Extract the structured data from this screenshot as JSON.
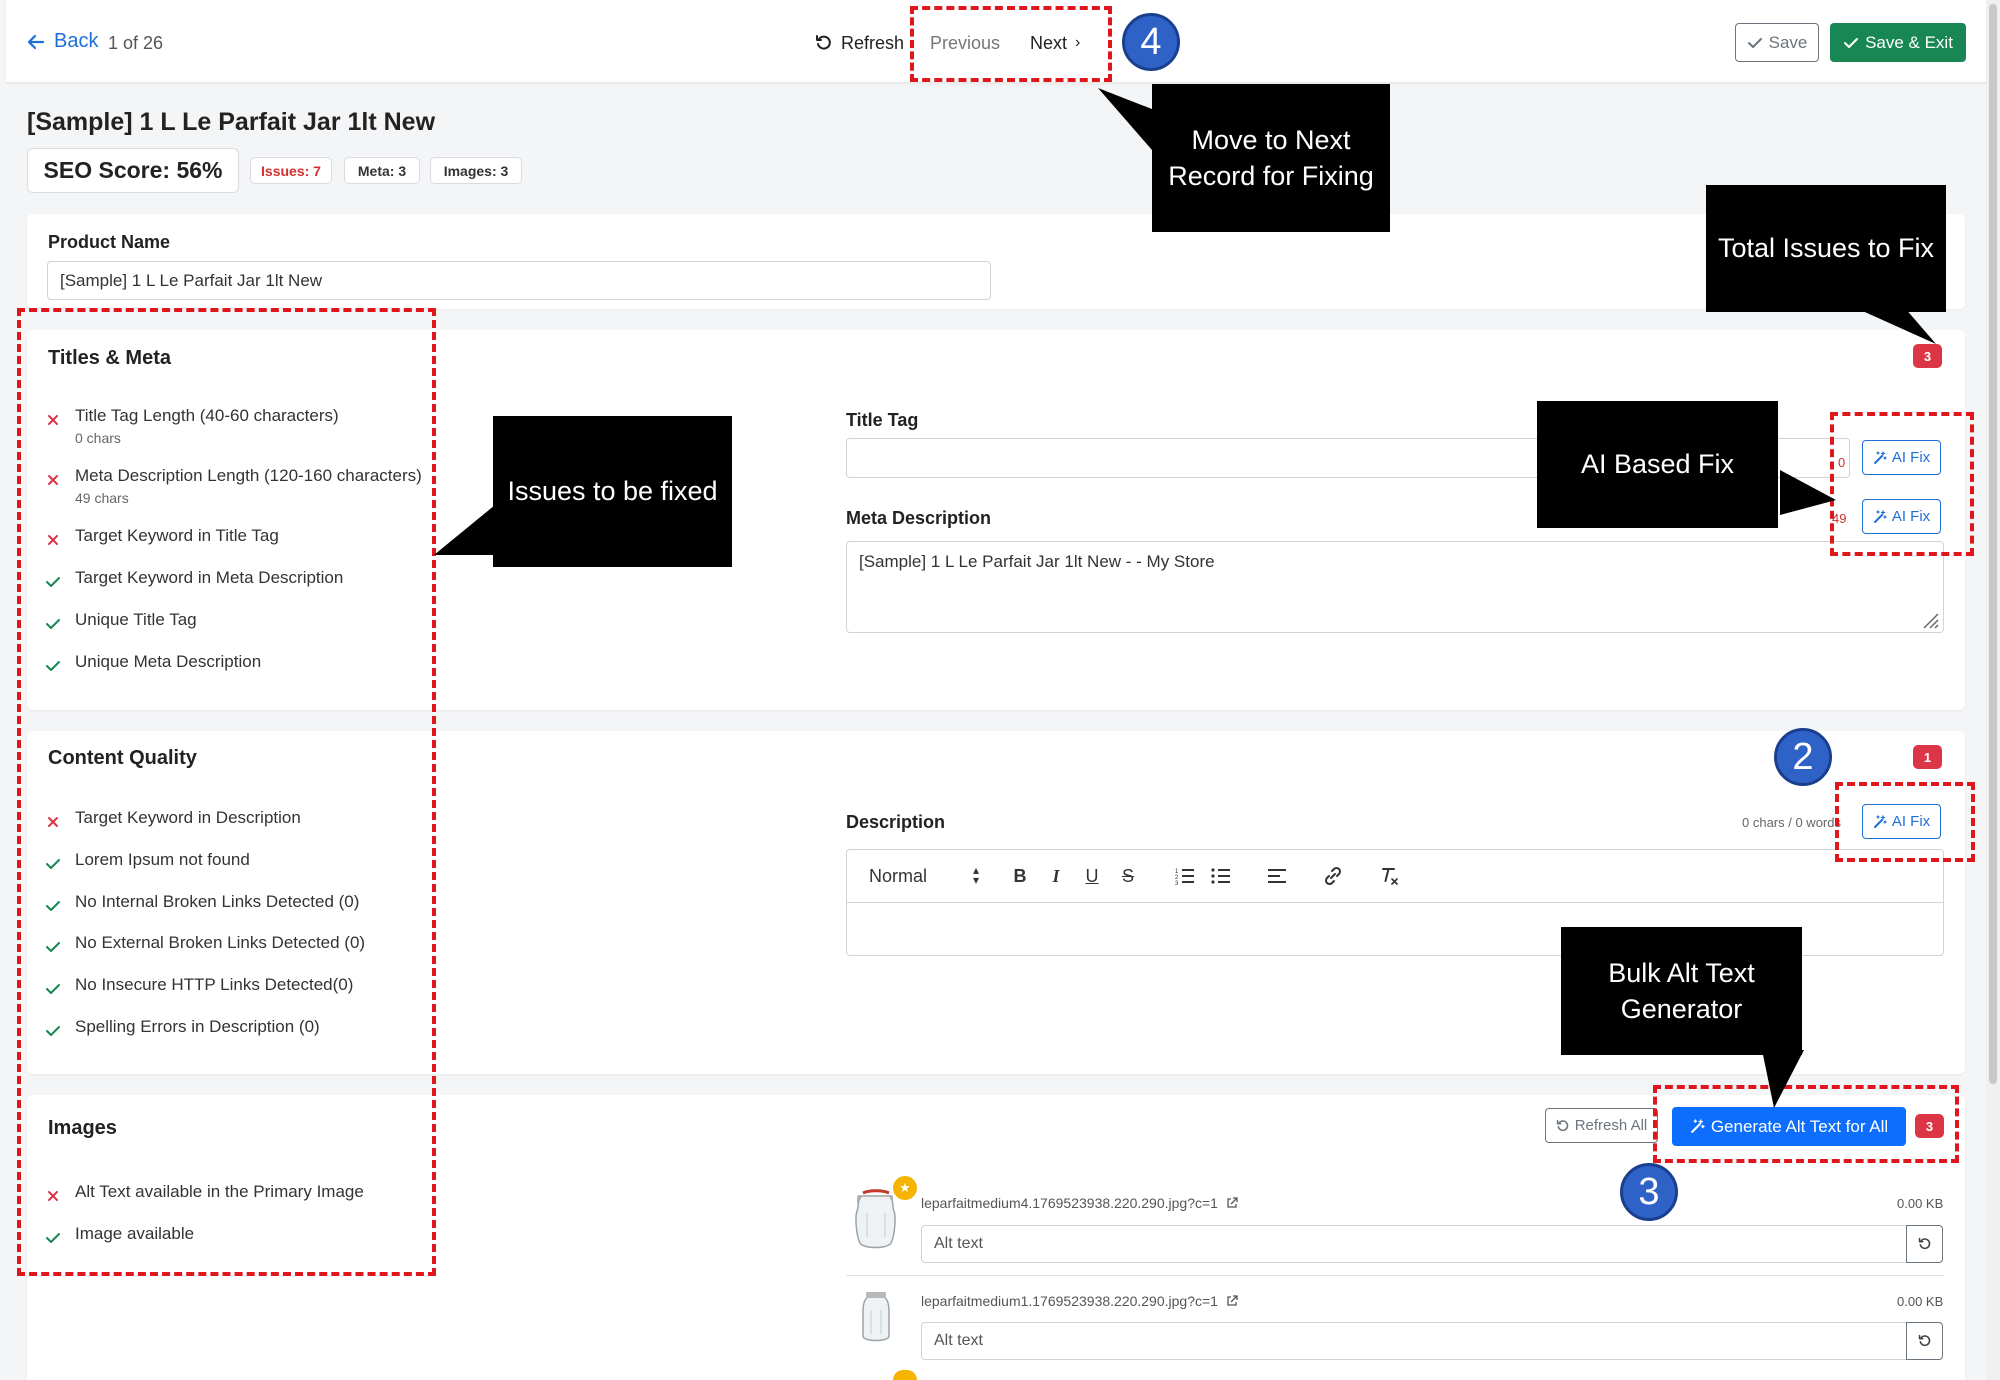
{
  "topbar": {
    "back_label": "Back",
    "record_position": "1 of 26",
    "refresh_label": "Refresh",
    "previous_label": "Previous",
    "next_label": "Next",
    "save_label": "Save",
    "save_exit_label": "Save & Exit"
  },
  "product": {
    "title": "[Sample] 1 L Le Parfait Jar 1lt New",
    "seo_score": "SEO Score: 56%",
    "issues_pill": "Issues: 7",
    "meta_pill": "Meta: 3",
    "images_pill": "Images: 3"
  },
  "product_name": {
    "label": "Product Name",
    "value": "[Sample] 1 L Le Parfait Jar 1lt New"
  },
  "titles_meta": {
    "title": "Titles & Meta",
    "badge": "3",
    "checks": [
      {
        "text": "Title Tag Length (40-60 characters)",
        "sub": "0 chars",
        "status": "fail"
      },
      {
        "text": "Meta Description Length (120-160 characters)",
        "sub": "49 chars",
        "status": "fail"
      },
      {
        "text": "Target Keyword in Title Tag",
        "status": "fail"
      },
      {
        "text": "Target Keyword in Meta Description",
        "status": "pass"
      },
      {
        "text": "Unique Title Tag",
        "status": "pass"
      },
      {
        "text": "Unique Meta Description",
        "status": "pass"
      }
    ],
    "title_tag_label": "Title Tag",
    "title_tag_value": "",
    "title_tag_count": "0",
    "meta_desc_label": "Meta Description",
    "meta_desc_value": "[Sample] 1 L Le Parfait Jar 1lt New -  - My Store",
    "meta_desc_count": "49",
    "ai_fix_label": "AI Fix"
  },
  "content_quality": {
    "title": "Content Quality",
    "badge": "1",
    "checks": [
      {
        "text": "Target Keyword in Description",
        "status": "fail"
      },
      {
        "text": "Lorem Ipsum not found",
        "status": "pass"
      },
      {
        "text": "No Internal Broken Links Detected (0)",
        "status": "pass"
      },
      {
        "text": "No External Broken Links Detected (0)",
        "status": "pass"
      },
      {
        "text": "No Insecure HTTP Links Detected(0)",
        "status": "pass"
      },
      {
        "text": "Spelling Errors in Description (0)",
        "status": "pass"
      }
    ],
    "description_label": "Description",
    "description_counter": "0 chars / 0 words",
    "ai_fix_label": "AI Fix",
    "toolbar": {
      "format_select": "Normal",
      "bold": "B",
      "italic": "I",
      "underline": "U",
      "strike": "S"
    }
  },
  "images": {
    "title": "Images",
    "badge": "3",
    "checks": [
      {
        "text": "Alt Text available in the Primary Image",
        "status": "fail"
      },
      {
        "text": "Image available",
        "status": "pass"
      }
    ],
    "refresh_all_label": "Refresh All",
    "generate_label": "Generate Alt Text for All",
    "items": [
      {
        "filename": "leparfaitmedium4.1769523938.220.290.jpg?c=1",
        "size": "0.00 KB",
        "alt_placeholder": "Alt text",
        "primary": true
      },
      {
        "filename": "leparfaitmedium1.1769523938.220.290.jpg?c=1",
        "size": "0.00 KB",
        "alt_placeholder": "Alt text",
        "primary": false
      }
    ]
  },
  "annotations": {
    "next_record": "Move to Next Record for Fixing",
    "total_issues": "Total Issues to Fix",
    "issues_to_fix": "Issues to be fixed",
    "ai_fix": "AI Based Fix",
    "bulk_alt": "Bulk Alt Text Generator",
    "step_2": "2",
    "step_3": "3",
    "step_4": "4"
  },
  "colors": {
    "primary": "#0d6efd",
    "success": "#198754",
    "danger": "#dc3545",
    "annotation_red": "#e0161d",
    "annotation_blue": "#2f62c7"
  }
}
